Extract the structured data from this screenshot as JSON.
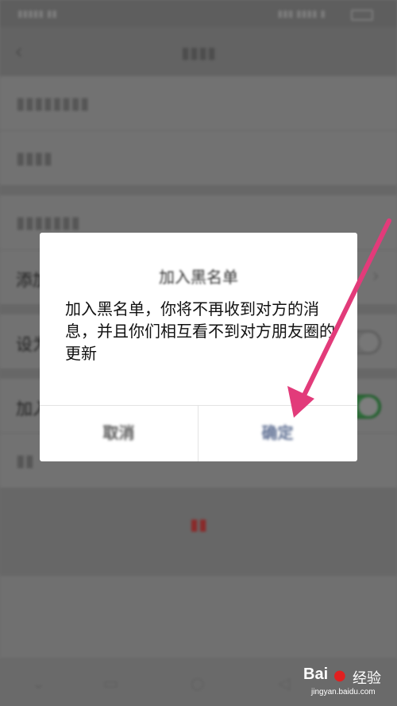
{
  "dialog": {
    "title": "加入黑名单",
    "message": "加入黑名单，你将不再收到对方的消息，并且你们相互看不到对方朋友圈的更新",
    "cancel_label": "取消",
    "confirm_label": "确定"
  },
  "background": {
    "partial_labels": [
      "添加",
      "设为",
      "加入"
    ],
    "toggles": {
      "set_as_off": false,
      "add_to_blacklist_on": true
    }
  },
  "watermark": {
    "brand": "Bai",
    "brand_suffix": "经验",
    "url": "jingyan.baidu.com"
  },
  "colors": {
    "arrow": "#e23b7a",
    "confirm_text": "#5c6d91",
    "toggle_on": "#2e6d3a"
  },
  "icons": {
    "back": "back-arrow-icon",
    "chevron": "chevron-right-icon",
    "paw": "baidu-paw-icon"
  }
}
